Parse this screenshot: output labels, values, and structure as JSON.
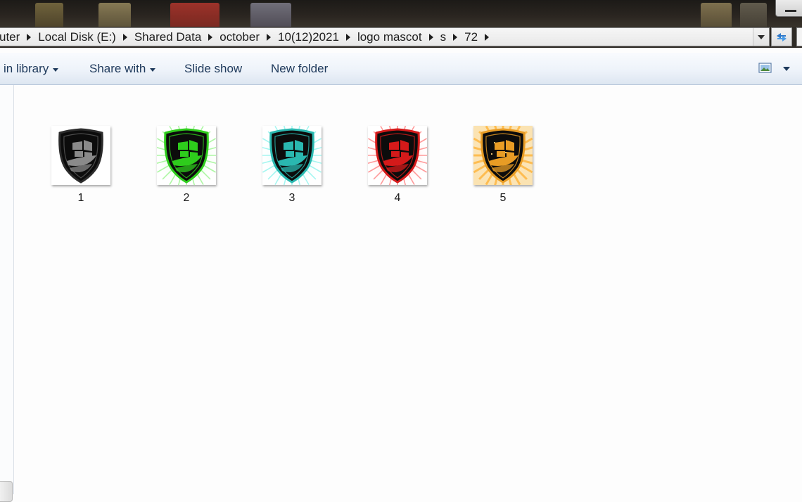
{
  "breadcrumbs": [
    "uter",
    "Local Disk (E:)",
    "Shared Data",
    "october",
    "10(12)2021",
    "logo mascot",
    "s",
    "72"
  ],
  "toolbar": {
    "include_in_library": "in library",
    "share_with": "Share with",
    "slide_show": "Slide show",
    "new_folder": "New folder"
  },
  "files": [
    {
      "name": "1",
      "icon": "ship-shield-icon",
      "theme": "black",
      "accent": "#8a8a8a",
      "glow": "#9a9a9a"
    },
    {
      "name": "2",
      "icon": "ship-shield-icon",
      "theme": "green",
      "accent": "#2ecc1c",
      "glow": "#6df25c"
    },
    {
      "name": "3",
      "icon": "ship-shield-icon",
      "theme": "cyan",
      "accent": "#2ab8b0",
      "glow": "#5ef0e6"
    },
    {
      "name": "4",
      "icon": "ship-shield-icon",
      "theme": "red",
      "accent": "#d41a1a",
      "glow": "#ff4a4a"
    },
    {
      "name": "5",
      "icon": "ship-shield-icon",
      "theme": "gold",
      "accent": "#e89c25",
      "glow": "#ffb43a"
    }
  ],
  "colors": {
    "command_bar_text": "#1e395b",
    "desktop_dark": "#2a2520"
  }
}
